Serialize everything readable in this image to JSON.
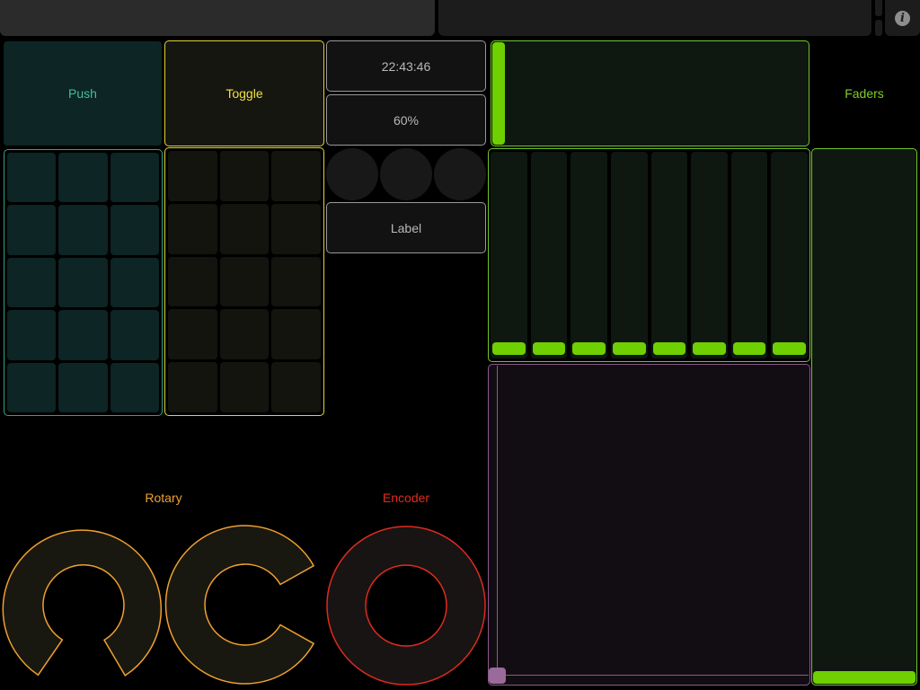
{
  "topbar": {
    "info_icon": "info-icon",
    "info_glyph": "i"
  },
  "push": {
    "label": "Push",
    "color": "#3fbfa0",
    "grid_rows": 5,
    "grid_cols": 3
  },
  "toggle": {
    "label": "Toggle",
    "color": "#e1d33a",
    "grid_rows": 5,
    "grid_cols": 3
  },
  "center": {
    "time": "22:43:46",
    "battery": "60%",
    "leds": 3,
    "label": "Label"
  },
  "faders": {
    "title": "Faders",
    "color": "#6ed000",
    "horizontal_value": 0.0,
    "multi_count": 8,
    "multi_values": [
      0,
      0,
      0,
      0,
      0,
      0,
      0,
      0
    ],
    "vertical_value": 0.0
  },
  "xy": {
    "color": "#9a6a9a",
    "x": 0.0,
    "y": 0.0
  },
  "rotary": {
    "title": "Rotary",
    "color": "#f0a030",
    "knobs": [
      {
        "type": "rotary-1",
        "value": 0.0
      },
      {
        "type": "rotary-2",
        "value": 0.0
      }
    ]
  },
  "encoder": {
    "title": "Encoder",
    "color": "#e02a20"
  }
}
